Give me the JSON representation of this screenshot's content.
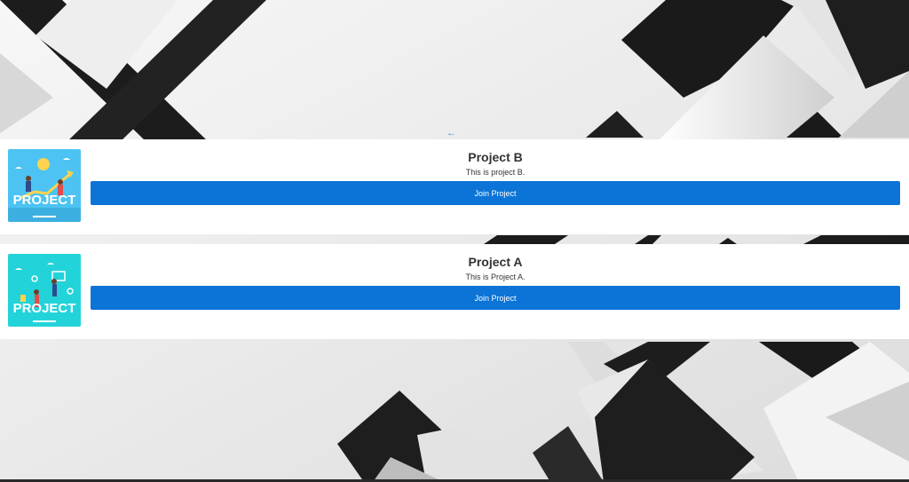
{
  "nav": {
    "back_arrow": "←"
  },
  "projects": [
    {
      "title": "Project B",
      "description": "This is project B.",
      "join_label": "Join Project",
      "thumbnail_text": "PROJECT",
      "thumbnail_color": "#4cc3f2"
    },
    {
      "title": "Project A",
      "description": "This is Project A.",
      "join_label": "Join Project",
      "thumbnail_text": "PROJECT",
      "thumbnail_color": "#22d3d9"
    }
  ],
  "colors": {
    "accent": "#0b74d6",
    "card_background": "#ffffff",
    "background_dark": "#1e1e1e",
    "background_light": "#ededed"
  },
  "icons": {
    "back": "back-arrow-icon",
    "thumbnail": "project-illustration-icon"
  }
}
